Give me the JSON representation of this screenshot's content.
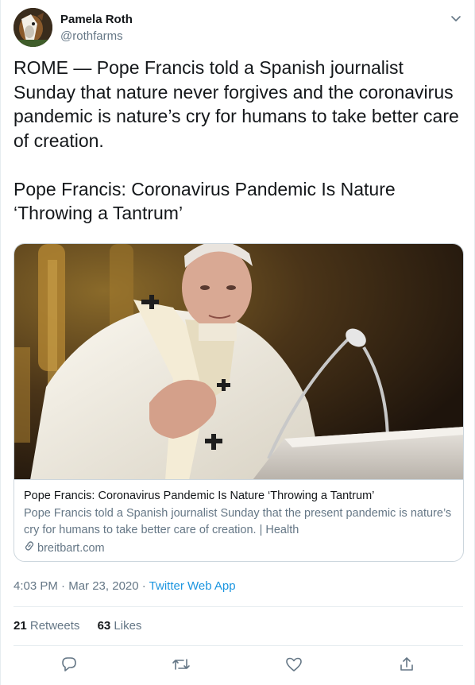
{
  "user": {
    "name": "Pamela Roth",
    "handle": "@rothfarms"
  },
  "tweet": {
    "text": "ROME — Pope Francis told a Spanish journalist Sunday that nature never forgives and the coronavirus pandemic is nature’s cry for humans to take better care of creation.\n\nPope Francis: Coronavirus Pandemic Is Nature ‘Throwing a Tantrum’"
  },
  "card": {
    "title": "Pope Francis: Coronavirus Pandemic Is Nature ‘Throwing a Tantrum’",
    "description": "Pope Francis told a Spanish journalist Sunday that the present pandemic is nature’s cry for humans to take better care of creation. | Health",
    "domain": "breitbart.com"
  },
  "meta": {
    "time": "4:03 PM",
    "separator": " · ",
    "date": "Mar 23, 2020",
    "separator2": " · ",
    "app": "Twitter Web App"
  },
  "stats": {
    "retweets_count": "21",
    "retweets_label": " Retweets",
    "likes_count": "63",
    "likes_label": " Likes"
  },
  "icons": {
    "caret": "chevron-down-icon",
    "reply": "reply-icon",
    "retweet": "retweet-icon",
    "like": "heart-icon",
    "share": "share-icon",
    "link": "link-icon"
  },
  "colors": {
    "text": "#14171a",
    "secondary": "#657786",
    "link": "#1b95e0",
    "border": "#e6ecf0"
  }
}
